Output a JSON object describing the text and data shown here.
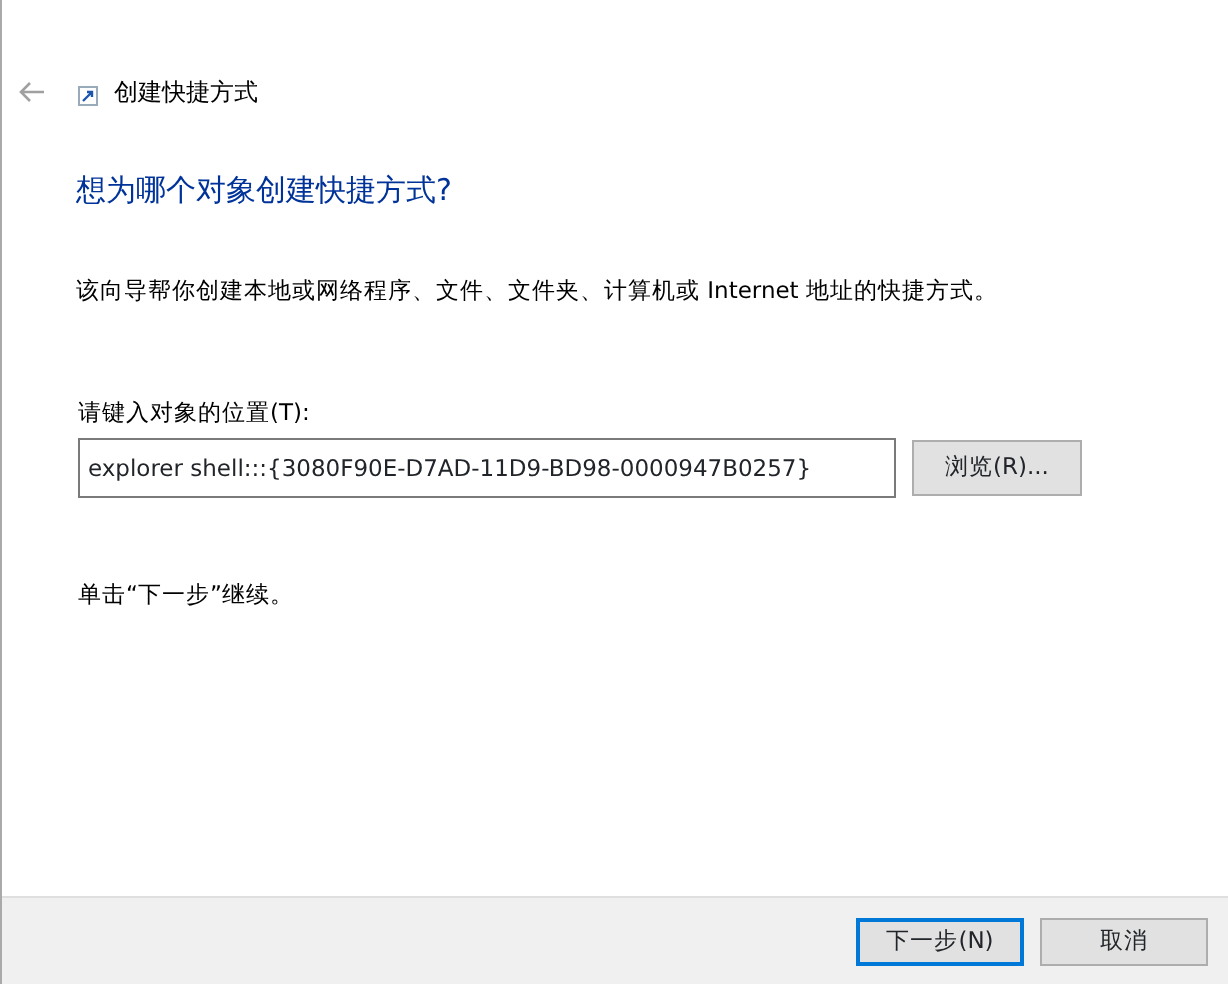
{
  "window": {
    "title": "创建快捷方式"
  },
  "heading": "想为哪个对象创建快捷方式?",
  "description": "该向导帮你创建本地或网络程序、文件、文件夹、计算机或 Internet 地址的快捷方式。",
  "location": {
    "label": "请键入对象的位置(T):",
    "value": "explorer shell:::{3080F90E-D7AD-11D9-BD98-0000947B0257}",
    "browse_button": "浏览(R)..."
  },
  "hint": "单击“下一步”继续。",
  "buttons": [
    {
      "label": "下一步(N)",
      "default": true
    },
    {
      "label": "取消",
      "default": false
    }
  ]
}
